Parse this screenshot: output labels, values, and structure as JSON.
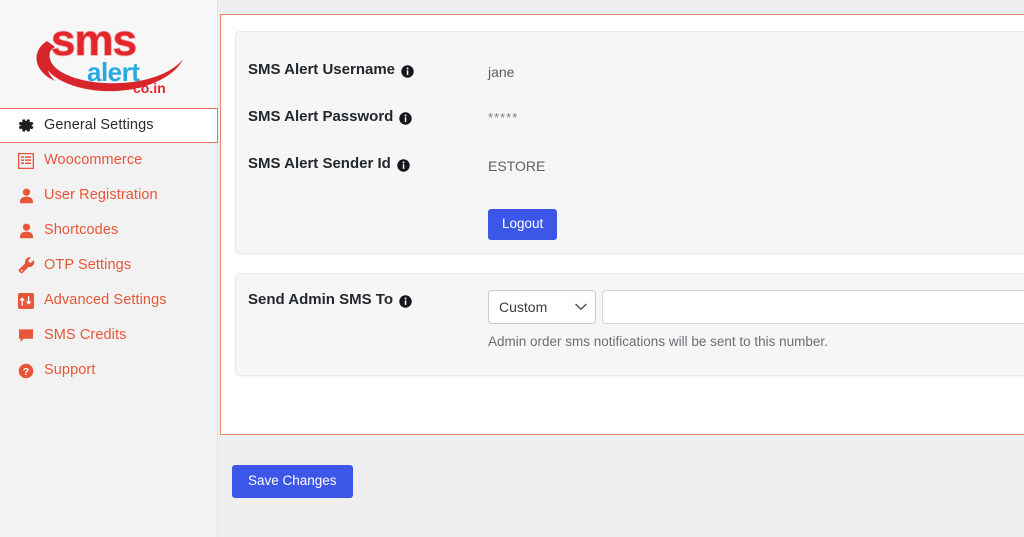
{
  "logo": {
    "text_primary": "sms",
    "text_secondary": "alert",
    "text_tld": "co.in",
    "color_primary": "#e1262c",
    "color_secondary": "#29a9e0",
    "name": "sms-alert-logo"
  },
  "sidebar": {
    "items": [
      {
        "label": "General Settings",
        "icon": "gear-icon",
        "active": true
      },
      {
        "label": "Woocommerce",
        "icon": "list-grid-icon",
        "active": false
      },
      {
        "label": "User Registration",
        "icon": "user-icon",
        "active": false
      },
      {
        "label": "Shortcodes",
        "icon": "user-icon",
        "active": false
      },
      {
        "label": "OTP Settings",
        "icon": "wrench-icon",
        "active": false
      },
      {
        "label": "Advanced Settings",
        "icon": "sliders-icon",
        "active": false
      },
      {
        "label": "SMS Credits",
        "icon": "chat-bubble-icon",
        "active": false
      },
      {
        "label": "Support",
        "icon": "question-circle-icon",
        "active": false
      }
    ],
    "accent_color": "#e8563a",
    "active_border_color": "#e8715a"
  },
  "account_card": {
    "fields": [
      {
        "label": "SMS Alert Username",
        "value": "jane",
        "info": "info-icon"
      },
      {
        "label": "SMS Alert Password",
        "value": "*****",
        "info": "info-icon"
      },
      {
        "label": "SMS Alert Sender Id",
        "value": "ESTORE",
        "info": "info-icon"
      }
    ],
    "logout_label": "Logout"
  },
  "admin_sms_card": {
    "label": "Send Admin SMS To",
    "select_value": "Custom",
    "select_options": [
      "Custom"
    ],
    "number_value": "",
    "number_placeholder": "",
    "helper_text": "Admin order sms notifications will be sent to this number."
  },
  "footer": {
    "save_label": "Save Changes"
  },
  "theme": {
    "button_blue": "#3c57e8",
    "panel_border": "#e8836c",
    "page_bg": "#efefef",
    "sidebar_bg": "#f2f2f2",
    "card_bg": "#f6f6f6"
  }
}
